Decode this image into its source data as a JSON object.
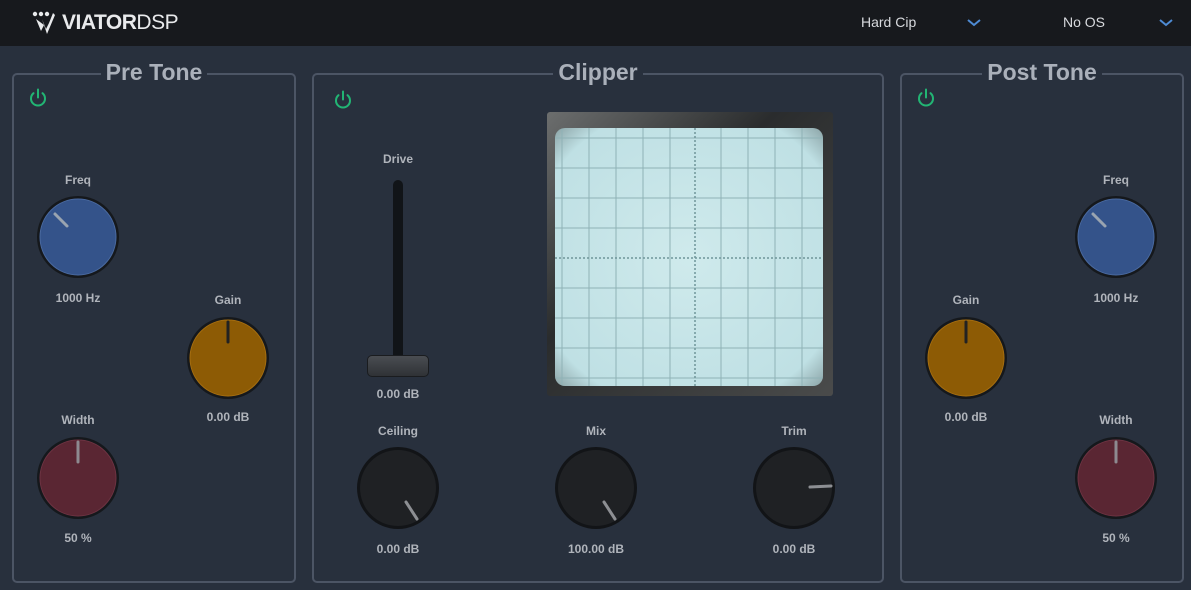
{
  "header": {
    "brand_bold": "VIATOR",
    "brand_light": "DSP",
    "clip_mode": "Hard Cip",
    "oversampling": "No OS"
  },
  "pre_tone": {
    "title": "Pre Tone",
    "freq": {
      "label": "Freq",
      "value": "1000 Hz"
    },
    "gain": {
      "label": "Gain",
      "value": "0.00 dB"
    },
    "width": {
      "label": "Width",
      "value": "50 %"
    }
  },
  "clipper": {
    "title": "Clipper",
    "drive": {
      "label": "Drive",
      "value": "0.00 dB",
      "level": 0
    },
    "ceiling": {
      "label": "Ceiling",
      "value": "0.00 dB"
    },
    "mix": {
      "label": "Mix",
      "value": "100.00 dB"
    },
    "trim": {
      "label": "Trim",
      "value": "0.00 dB"
    }
  },
  "post_tone": {
    "title": "Post Tone",
    "freq": {
      "label": "Freq",
      "value": "1000 Hz"
    },
    "gain": {
      "label": "Gain",
      "value": "0.00 dB"
    },
    "width": {
      "label": "Width",
      "value": "50 %"
    }
  },
  "colors": {
    "power_on": "#22b574",
    "freq_knob": "#34538a",
    "gain_knob": "#8d5b05",
    "width_knob": "#5a2633",
    "dark_knob": "#1f2124",
    "scope_screen": "#c9e7ea"
  },
  "icons": {
    "power": "power-icon",
    "dropdown": "chevron-down-icon"
  }
}
